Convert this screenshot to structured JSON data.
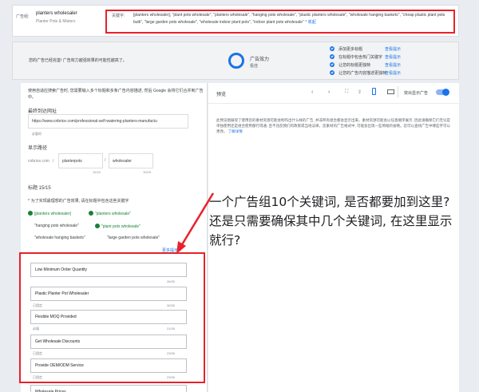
{
  "ad_group": {
    "label": "广告组:",
    "name": "planters wholesaler",
    "subtitle": "Planter Pots & Misters"
  },
  "keywords": {
    "label": "关键字:",
    "text": "[planters wholesaler], \"plant pots wholesale\", \"planters wholesale\", \"hanging pots wholesale\", \"plastic planters wholesale\", \"wholesale hanging baskets\", \"cheap plastic plant pots bulk\", \"large garden pots wholesale\", \"wholesale indoor plant pots\", \"indoor plant pots wholesale\"",
    "collapse": "^ 收起"
  },
  "ad_strength": {
    "message": "您的广告已经完善! 广告效力越强效果的可能性越高了。",
    "title": "广告效力",
    "level": "极佳",
    "checks": [
      {
        "label": "添加更多标题",
        "link": "查看提示"
      },
      {
        "label": "在标题中包含热门关键字",
        "link": "查看提示"
      },
      {
        "label": "让您的标题更独特",
        "link": "查看提示"
      },
      {
        "label": "让您的广告内容描述更独特",
        "link": "查看提示"
      }
    ]
  },
  "editor": {
    "intro": "使用自适应搜索广告时, 您需要输入多个标题和多条广告内容描述, 然后 Google 会将它们合并到广告中。",
    "final_url_label": "最终到达网址",
    "final_url_value": "https://www.cnbrice.com/professional-self-watering-planters-manufactu",
    "final_url_helper": "必要的",
    "display_path_label": "显示路径",
    "domain": "cnbrice.com",
    "path1": "planterpots",
    "path2": "wholesaler",
    "path1_count": "11/15",
    "path2_count": "10/15",
    "headlines_label": "标题 15/15",
    "suggestions_toggle": "^ 为了实现最理想的广告效果, 请在标题中包含这些关键字",
    "keyword_suggestions": {
      "k1": "[planters wholesaler]",
      "k2": "\"planters wholesale\"",
      "k3": "\"hanging pots wholesale\"",
      "k4": "\"plant pots wholesale\"",
      "k5": "\"wholesale hanging baskets\"",
      "k6": "\"large garden pots wholesale\""
    },
    "more_ideas": "更多提示 >",
    "headlines": [
      {
        "text": "Low Minimum Order Quantity",
        "pin": "",
        "count": "26/30"
      },
      {
        "text": "Plastic Planter Pot Wholesaler",
        "pin": "已固定",
        "count": "30/30"
      },
      {
        "text": "Flexible MOQ Provided",
        "pin": "必填",
        "count": "21/30"
      },
      {
        "text": "Get Wholesale Discounts",
        "pin": "已固定",
        "count": "23/30"
      },
      {
        "text": "Provide OEM/ODM Service",
        "pin": "已固定",
        "count": "23/30"
      },
      {
        "text": "Wholesale Prices",
        "pin": "",
        "count": ""
      }
    ]
  },
  "preview": {
    "label": "预览",
    "show_ad_label": "突出显示广告",
    "note": "此预览图展现了使用您的素材资源可能会制作出什么样的广告, 并非所有组合都会显示出来。素材资源可能会以任意顺序展示, 因此请确保它们无论是单独使用还是组合使用都行得通, 且不违反我们的政策或当地法律。您素材的广告格式中, 可能会出现一些简缩的省略。您可以查找广告中哪些字可以更改。",
    "note_link": "了解详情"
  },
  "annotation": {
    "question": "一个广告组10个关键词, 是否都要加到这里? 还是只需要确保其中几个关键词, 在这里显示就行?"
  },
  "colors": {
    "accent": "#1a73e8",
    "annotation_red": "#e8212b",
    "success_green": "#188038"
  }
}
